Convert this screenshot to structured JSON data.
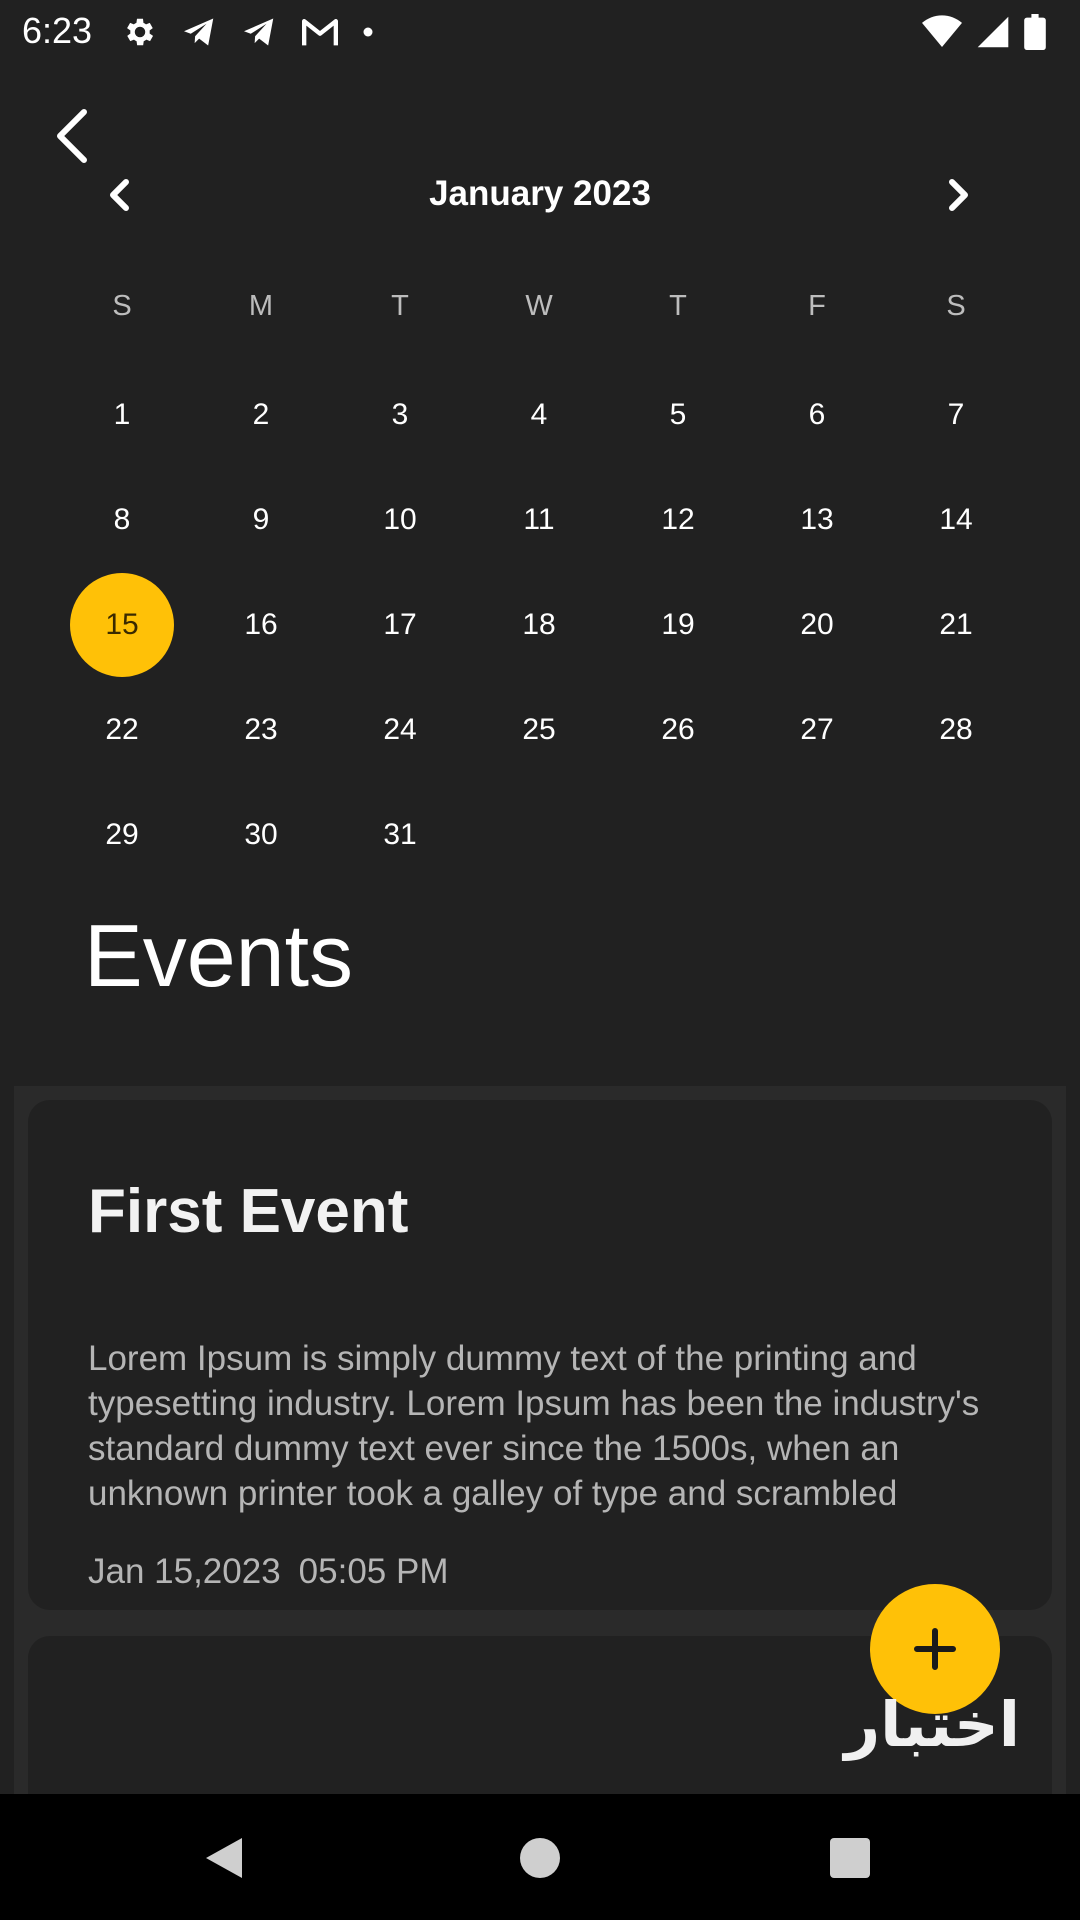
{
  "status_bar": {
    "time": "6:23",
    "left_icons": [
      "gear-icon",
      "telegram-icon",
      "telegram-icon",
      "gmail-icon",
      "dot-icon"
    ],
    "right_icons": [
      "wifi-icon",
      "cellular-signal-icon",
      "battery-icon"
    ]
  },
  "header": {
    "back_icon": "back-arrow-icon"
  },
  "calendar": {
    "month_label": "January 2023",
    "prev_icon": "chevron-left-icon",
    "next_icon": "chevron-right-icon",
    "weekdays": [
      "S",
      "M",
      "T",
      "W",
      "T",
      "F",
      "S"
    ],
    "days": [
      "1",
      "2",
      "3",
      "4",
      "5",
      "6",
      "7",
      "8",
      "9",
      "10",
      "11",
      "12",
      "13",
      "14",
      "15",
      "16",
      "17",
      "18",
      "19",
      "20",
      "21",
      "22",
      "23",
      "24",
      "25",
      "26",
      "27",
      "28",
      "29",
      "30",
      "31"
    ],
    "selected_day": "15",
    "accent_color": "#ffc107"
  },
  "events": {
    "title": "Events",
    "items": [
      {
        "title": "First Event",
        "description": "Lorem Ipsum is simply dummy text of the printing and typesetting industry. Lorem Ipsum has been the industry's standard dummy text ever since the 1500s, when an unknown printer took a galley of type and scrambled",
        "date": "Jan 15,2023",
        "time": "05:05 PM"
      }
    ]
  },
  "fab": {
    "icon": "plus-icon",
    "label": "اختبار"
  },
  "nav_bar": {
    "icons": [
      "nav-back-icon",
      "nav-home-icon",
      "nav-recents-icon"
    ]
  }
}
